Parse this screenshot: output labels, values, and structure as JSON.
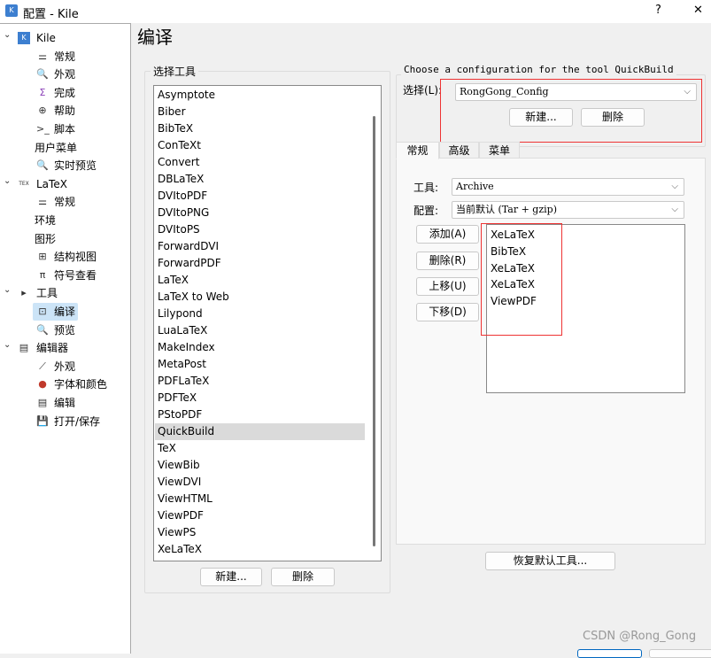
{
  "window": {
    "title": "配置 - Kile",
    "help": "?",
    "close": "✕"
  },
  "sidebar": {
    "items": [
      {
        "label": "Kile",
        "level": 0,
        "icon": "kile-icon"
      },
      {
        "label": "常规",
        "level": 1,
        "icon": "sliders-icon"
      },
      {
        "label": "外观",
        "level": 1,
        "icon": "preview-icon"
      },
      {
        "label": "完成",
        "level": 1,
        "icon": "sigma-icon"
      },
      {
        "label": "帮助",
        "level": 1,
        "icon": "lifebuoy-icon"
      },
      {
        "label": "脚本",
        "level": 1,
        "icon": "terminal-icon"
      },
      {
        "label": "用户菜单",
        "level": 1,
        "icon": ""
      },
      {
        "label": "实时预览",
        "level": 1,
        "icon": "preview-icon"
      },
      {
        "label": "LaTeX",
        "level": 0,
        "icon": "tex-icon"
      },
      {
        "label": "常规",
        "level": 1,
        "icon": "sliders-icon"
      },
      {
        "label": "环境",
        "level": 1,
        "icon": ""
      },
      {
        "label": "图形",
        "level": 1,
        "icon": ""
      },
      {
        "label": "结构视图",
        "level": 1,
        "icon": "structure-icon"
      },
      {
        "label": "符号查看",
        "level": 1,
        "icon": "pi-icon"
      },
      {
        "label": "工具",
        "level": 0,
        "icon": "tools-icon"
      },
      {
        "label": "编译",
        "level": 1,
        "icon": "build-icon",
        "selected": true
      },
      {
        "label": "预览",
        "level": 1,
        "icon": "preview-icon"
      },
      {
        "label": "编辑器",
        "level": 0,
        "icon": "editor-icon"
      },
      {
        "label": "外观",
        "level": 1,
        "icon": "appearance-icon"
      },
      {
        "label": "字体和颜色",
        "level": 1,
        "icon": "color-wheel-icon"
      },
      {
        "label": "编辑",
        "level": 1,
        "icon": "editor-icon"
      },
      {
        "label": "打开/保存",
        "level": 1,
        "icon": "save-icon"
      }
    ]
  },
  "page": {
    "title": "编译"
  },
  "tools": {
    "group_label": "选择工具",
    "items": [
      "Asymptote",
      "Biber",
      "BibTeX",
      "ConTeXt",
      "Convert",
      "DBLaTeX",
      "DVItoPDF",
      "DVItoPNG",
      "DVItoPS",
      "ForwardDVI",
      "ForwardPDF",
      "LaTeX",
      "LaTeX to Web",
      "Lilypond",
      "LuaLaTeX",
      "MakeIndex",
      "MetaPost",
      "PDFLaTeX",
      "PDFTeX",
      "PStoPDF",
      "QuickBuild",
      "TeX",
      "ViewBib",
      "ViewDVI",
      "ViewHTML",
      "ViewPDF",
      "ViewPS",
      "XeLaTeX"
    ],
    "selected": "QuickBuild",
    "new_label": "新建...",
    "delete_label": "删除"
  },
  "config": {
    "group_label": "Choose a configuration for the tool QuickBuild",
    "select_label": "选择(L):",
    "value": "RongGong_Config",
    "new_label": "新建...",
    "delete_label": "删除"
  },
  "tabs": [
    "常规",
    "高级",
    "菜单"
  ],
  "general": {
    "tool_label": "工具:",
    "tool_value": "Archive",
    "config_label": "配置:",
    "config_value": "当前默认 (Tar + gzip)",
    "add": "添加(A)",
    "remove": "删除(R)",
    "up": "上移(U)",
    "down": "下移(D)",
    "sequence": [
      "XeLaTeX",
      "BibTeX",
      "XeLaTeX",
      "XeLaTeX",
      "ViewPDF"
    ]
  },
  "restore_label": "恢复默认工具...",
  "watermark": "CSDN @Rong_Gong",
  "colors": {
    "highlight": "#e33333",
    "selection": "#cce4f7",
    "list_selected": "#dadada"
  }
}
